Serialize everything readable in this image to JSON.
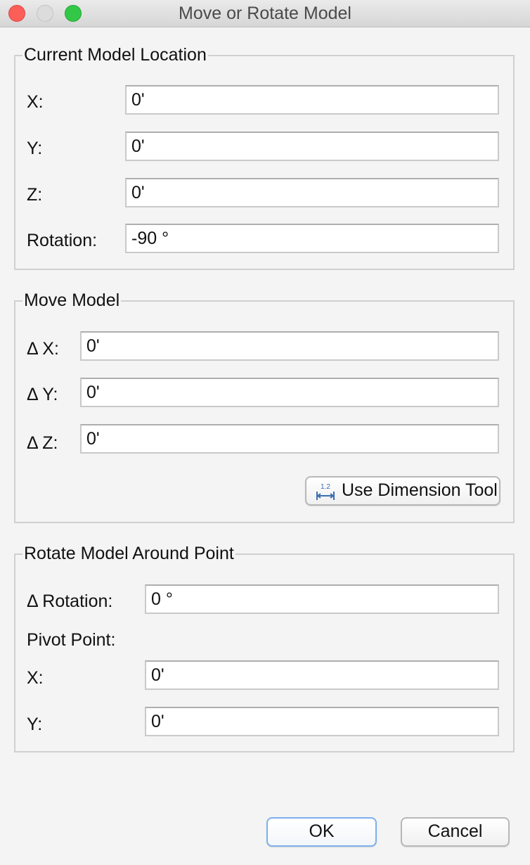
{
  "window": {
    "title": "Move or Rotate Model"
  },
  "current_location": {
    "title": "Current Model Location",
    "x_label": "X:",
    "x_value": "0'",
    "y_label": "Y:",
    "y_value": "0'",
    "z_label": "Z:",
    "z_value": "0'",
    "rotation_label": "Rotation:",
    "rotation_value": "-90 °"
  },
  "move_model": {
    "title": "Move Model",
    "dx_label": "Δ X:",
    "dx_value": "0'",
    "dy_label": "Δ Y:",
    "dy_value": "0'",
    "dz_label": "Δ Z:",
    "dz_value": "0'",
    "dimension_tool_label": "Use Dimension Tool",
    "dimension_tool_icon": "dimension-tool-icon"
  },
  "rotate_model": {
    "title": "Rotate Model Around Point",
    "drot_label": "Δ Rotation:",
    "drot_value": "0 °",
    "pivot_label": "Pivot Point:",
    "px_label": "X:",
    "px_value": "0'",
    "py_label": "Y:",
    "py_value": "0'"
  },
  "buttons": {
    "ok_label": "OK",
    "cancel_label": "Cancel"
  }
}
